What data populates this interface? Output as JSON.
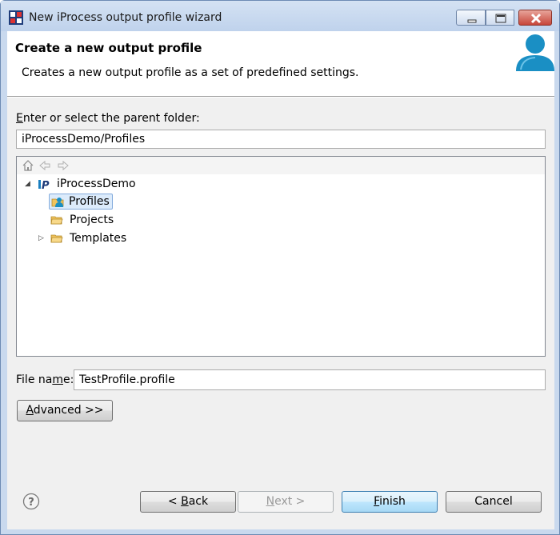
{
  "window": {
    "title": "New iProcess output profile wizard"
  },
  "header": {
    "title": "Create a new output profile",
    "description": "Creates a new output profile as a set of predefined settings."
  },
  "folder": {
    "label_prefix": "",
    "label_mnemonic": "E",
    "label_rest": "nter or select the parent folder:",
    "value": "iProcessDemo/Profiles"
  },
  "tree": {
    "root": {
      "label": "iProcessDemo",
      "expanded": true
    },
    "children": [
      {
        "label": "Profiles",
        "selected": true
      },
      {
        "label": "Projects",
        "selected": false
      },
      {
        "label": "Templates",
        "selected": false,
        "has_children": true
      }
    ]
  },
  "filename": {
    "label_prefix": "File na",
    "label_mnemonic": "m",
    "label_rest": "e:",
    "value": "TestProfile.profile"
  },
  "buttons": {
    "advanced_mnemonic": "A",
    "advanced_rest": "dvanced >>",
    "back_prefix": "< ",
    "back_mnemonic": "B",
    "back_rest": "ack",
    "next_mnemonic": "N",
    "next_rest": "ext >",
    "finish_mnemonic": "F",
    "finish_rest": "inish",
    "cancel_label": "Cancel"
  },
  "colors": {
    "selection_bg": "#dcebfb",
    "selection_border": "#84acdd",
    "titlebar": "#c9d9ee",
    "user_icon": "#1a8fc4"
  }
}
